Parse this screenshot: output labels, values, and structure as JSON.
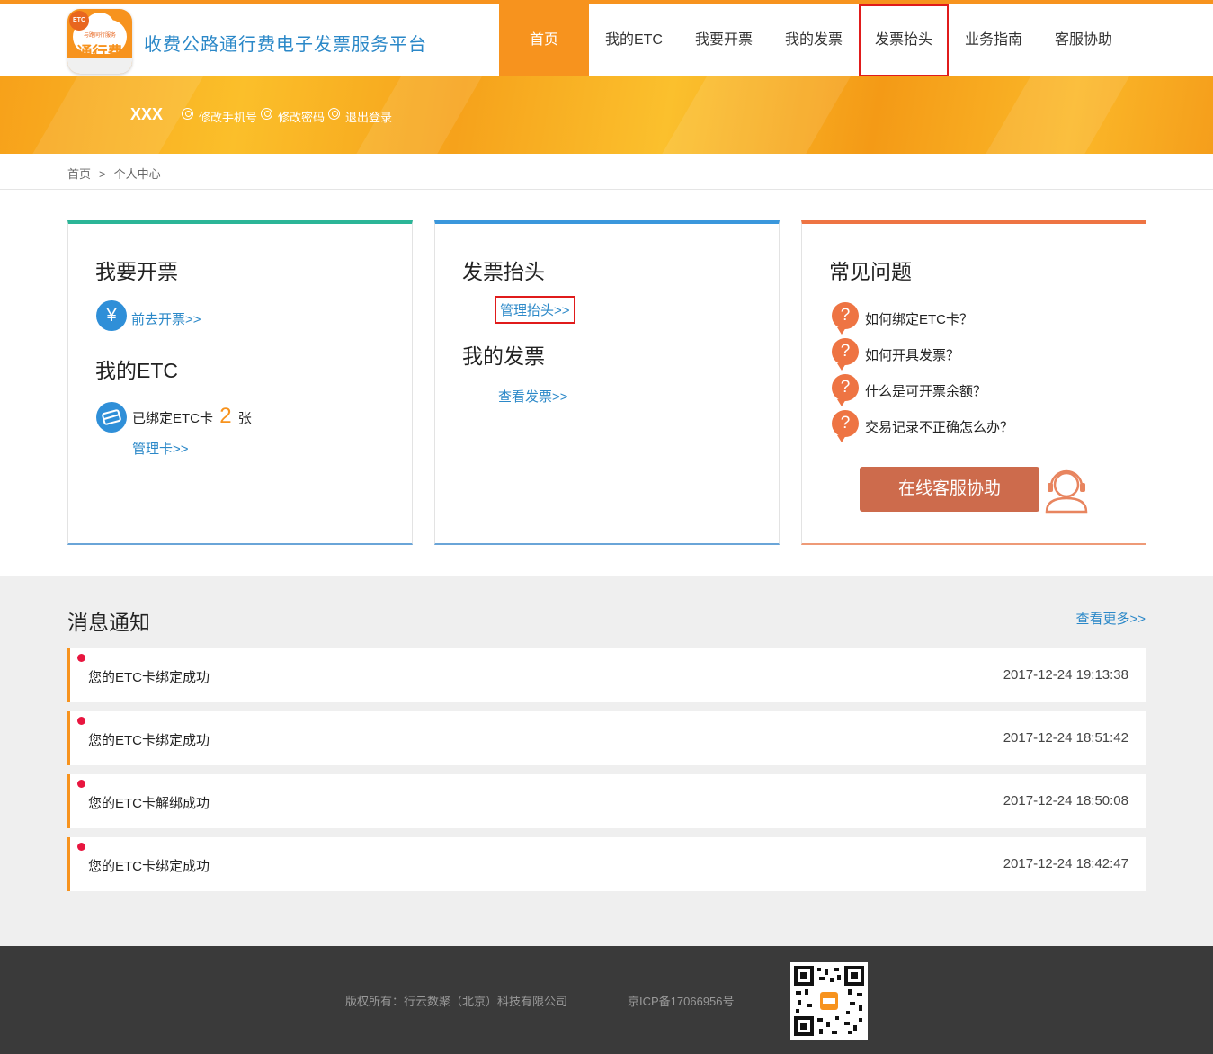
{
  "header": {
    "logo_badge": "ETC",
    "logo_sub": "与路同行服务",
    "logo_text": "通行费",
    "site_title": "收费公路通行费电子发票服务平台",
    "nav": [
      {
        "label": "首页",
        "active": true
      },
      {
        "label": "我的ETC"
      },
      {
        "label": "我要开票"
      },
      {
        "label": "我的发票"
      },
      {
        "label": "发票抬头",
        "highlighted": true
      },
      {
        "label": "业务指南"
      },
      {
        "label": "客服协助"
      }
    ]
  },
  "banner": {
    "username": "XXX",
    "links": [
      "修改手机号",
      "修改密码",
      "退出登录"
    ]
  },
  "breadcrumb": {
    "home": "首页",
    "separator": ">",
    "current": "个人中心"
  },
  "cards": {
    "invoice": {
      "title": "我要开票",
      "icon": "yuan-icon",
      "link": "前去开票>>"
    },
    "etc": {
      "title": "我的ETC",
      "icon": "card-icon",
      "bound_prefix": "已绑定ETC卡",
      "bound_count": "2",
      "bound_suffix": "张",
      "link": "管理卡>>"
    },
    "header": {
      "title": "发票抬头",
      "link": "管理抬头>>"
    },
    "my_invoice": {
      "title": "我的发票",
      "link": "查看发票>>"
    },
    "faq": {
      "title": "常见问题",
      "items": [
        "如何绑定ETC卡？",
        "如何开具发票？",
        "什么是可开票余额？",
        "交易记录不正确怎么办？"
      ],
      "service_button": "在线客服协助",
      "service_icon": "headset-agent-icon"
    }
  },
  "notifications": {
    "title": "消息通知",
    "more": "查看更多>>",
    "items": [
      {
        "message": "您的ETC卡绑定成功",
        "time": "2017-12-24 19:13:38"
      },
      {
        "message": "您的ETC卡绑定成功",
        "time": "2017-12-24 18:51:42"
      },
      {
        "message": "您的ETC卡解绑成功",
        "time": "2017-12-24 18:50:08"
      },
      {
        "message": "您的ETC卡绑定成功",
        "time": "2017-12-24 18:42:47"
      }
    ]
  },
  "footer": {
    "copyright": "版权所有：行云数聚（北京）科技有限公司",
    "icp": "京ICP备17066956号",
    "qr_icon": "qr-code-icon"
  },
  "colors": {
    "accent": "#f7931e",
    "link": "#2b88c8",
    "faq": "#ee7443",
    "highlight_box": "#e01b1b"
  }
}
